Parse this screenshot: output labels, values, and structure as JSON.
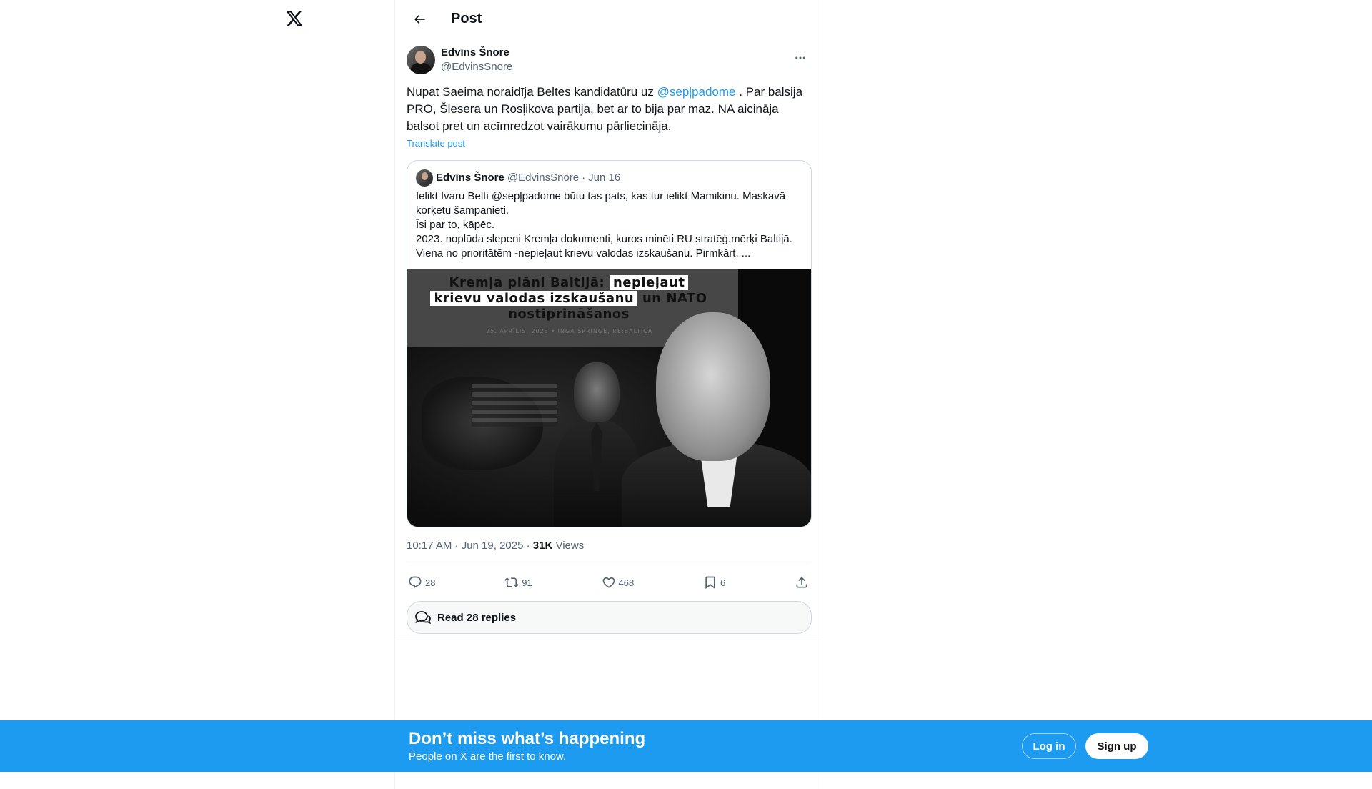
{
  "header": {
    "title": "Post"
  },
  "post": {
    "author_name": "Edvīns Šnore",
    "author_handle": "@EdvinsSnore",
    "text_before": "Nupat Saeima noraidīja Beltes kandidatūru uz ",
    "mention": "@sepļpadome",
    "text_after": " . Par balsija PRO, Šlesera un Rosļikova partija, bet ar to bija par maz. NA aicināja balsot pret un acīmredzot vairākumu pārliecināja.",
    "translate_label": "Translate post",
    "timestamp": "10:17 AM · Jun 19, 2025 · ",
    "views_count": "31K",
    "views_label": " Views"
  },
  "quote": {
    "author_name": "Edvīns Šnore",
    "author_handle": "@EdvinsSnore",
    "dot": "·",
    "date": "Jun 16",
    "text": "Ielikt Ivaru Belti @sepļpadome būtu tas pats, kas tur ielikt Mamikinu. Maskavā korķētu šampanieti.\nĪsi par to, kāpēc.\n2023. noplūda slepeni Kremļa dokumenti, kuros minēti RU stratēģ.mērķi Baltijā. Viena no prioritātēm -nepieļaut krievu valodas izskaušanu. Pirmkārt, ...",
    "image": {
      "headline_plain_1": "Kremļa plāni Baltijā: ",
      "headline_hl_1": "nepieļaut",
      "headline_hl_2": "krievu valodas izskaušanu",
      "headline_plain_2": " un NATO",
      "headline_plain_3": "nostiprināšanos",
      "byline": "25. APRĪLIS, 2023  •  INGA SPRIŅĢE, RE:BALTICA"
    }
  },
  "actions": {
    "replies": "28",
    "reposts": "91",
    "likes": "468",
    "bookmarks": "6"
  },
  "read_replies_label": "Read 28 replies",
  "banner": {
    "title": "Don’t miss what’s happening",
    "subtitle": "People on X are the first to know.",
    "login_label": "Log in",
    "signup_label": "Sign up"
  },
  "colors": {
    "accent": "#1d9bf0",
    "text": "#0f1419",
    "secondary": "#536471"
  },
  "icons": [
    "x-logo-icon",
    "back-arrow-icon",
    "more-icon",
    "reply-icon",
    "repost-icon",
    "like-icon",
    "bookmark-icon",
    "share-icon",
    "chat-bubbles-icon"
  ]
}
